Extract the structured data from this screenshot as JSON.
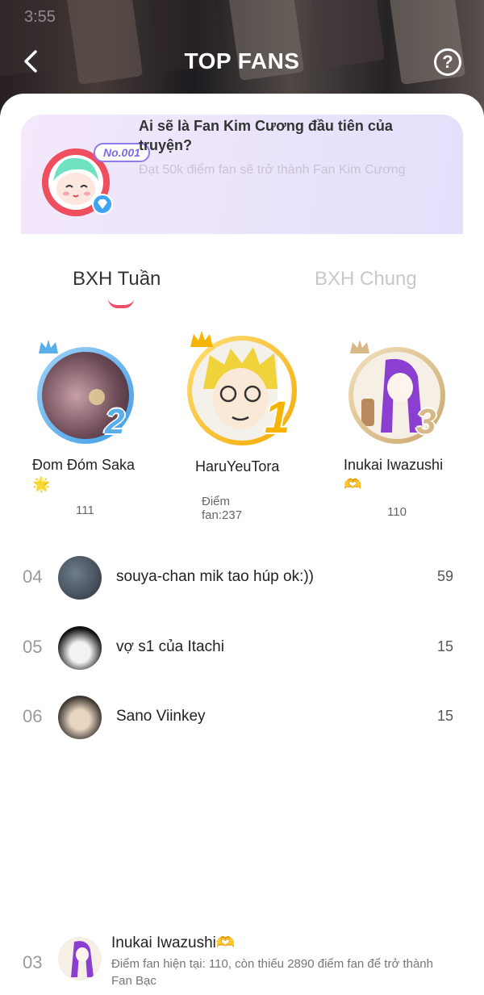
{
  "header": {
    "title": "TOP FANS",
    "status_ghost": "3:55"
  },
  "banner": {
    "badge": "No.001",
    "title": "Ai sẽ là Fan Kim Cương đầu tiên của truyện?",
    "subtitle": "Đạt 50k điểm fan sẽ trở thành Fan Kim Cương"
  },
  "tabs": [
    {
      "label": "BXH Tuần",
      "active": true
    },
    {
      "label": "BXH Chung",
      "active": false
    }
  ],
  "podium": [
    {
      "rank": "2",
      "name": "Đom Đóm Saka🌟",
      "score": "111"
    },
    {
      "rank": "1",
      "name": "HaruYeuTora",
      "score": "Điểm fan:237"
    },
    {
      "rank": "3",
      "name": "Inukai Iwazushi🫶",
      "score": "110"
    }
  ],
  "list": [
    {
      "rank": "04",
      "name": "souya-chan mik tao húp ok:))",
      "score": "59"
    },
    {
      "rank": "05",
      "name": "vợ s1 của Itachi",
      "score": "15"
    },
    {
      "rank": "06",
      "name": "Sano Viinkey",
      "score": "15"
    }
  ],
  "me": {
    "rank": "03",
    "name": "Inukai Iwazushi🫶",
    "info": "Điểm fan hiện tại: 110, còn thiếu 2890 điểm fan để trở thành Fan Bạc"
  },
  "colors": {
    "accent": "#ee4d6a",
    "gold": "#f5b400",
    "silver_blue": "#5aaeea",
    "bronze": "#d8b886"
  }
}
